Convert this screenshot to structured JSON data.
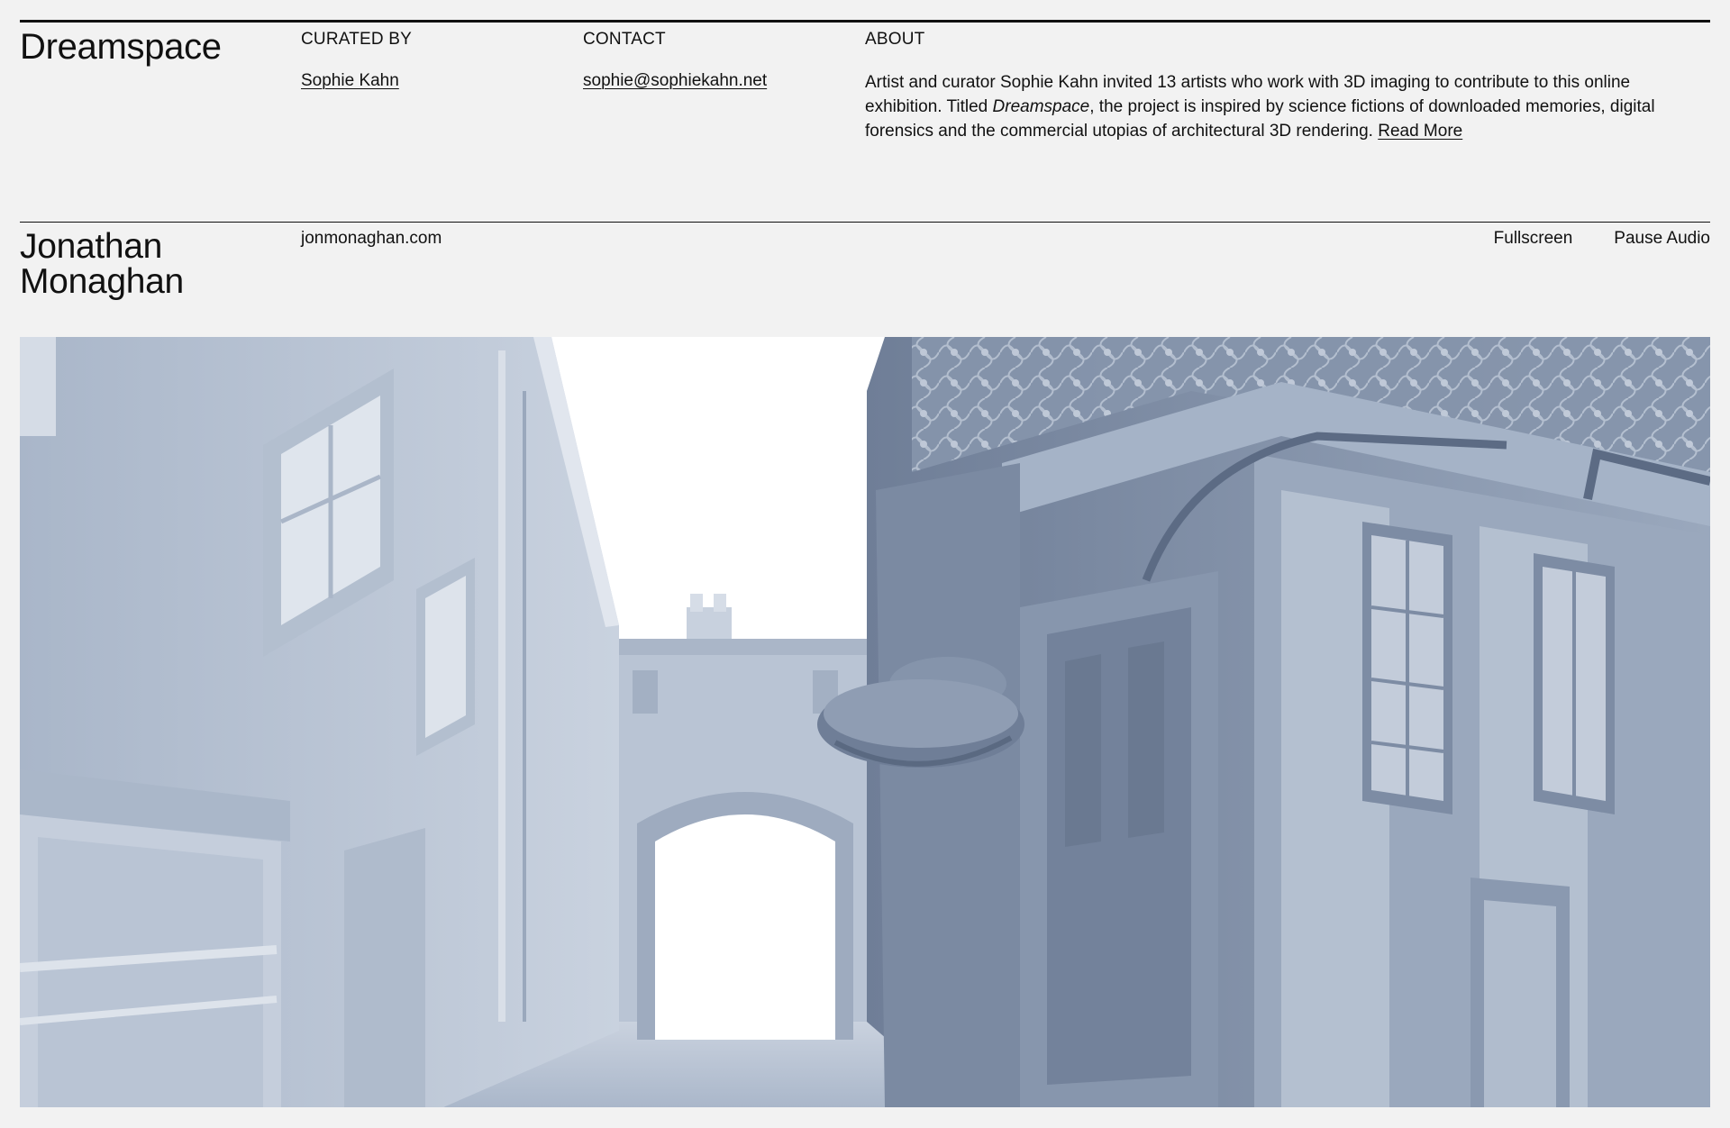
{
  "header": {
    "site_title": "Dreamspace",
    "curated_by": {
      "label": "CURATED BY",
      "value": "Sophie Kahn"
    },
    "contact": {
      "label": "CONTACT",
      "value": "sophie@sophiekahn.net"
    },
    "about": {
      "label": "ABOUT",
      "text_before": "Artist and curator Sophie Kahn invited 13 artists who work with 3D imaging to contribute to this online exhibition. Titled ",
      "title_em": "Dreamspace",
      "text_after": ", the project is inspired by science fictions of downloaded memories, digital forensics and the commercial utopias of architectural 3D rendering. ",
      "read_more": "Read More"
    }
  },
  "artist": {
    "name_line1": "Jonathan",
    "name_line2": "Monaghan",
    "website": "jonmonaghan.com",
    "fullscreen_label": "Fullscreen",
    "pause_audio_label": "Pause Audio"
  },
  "scene": {
    "sky_color": "#ffffff",
    "building_light": "#c6d0de",
    "building_mid": "#a6b4c8",
    "building_dark": "#7f8ea6",
    "building_shadow": "#66758e"
  }
}
